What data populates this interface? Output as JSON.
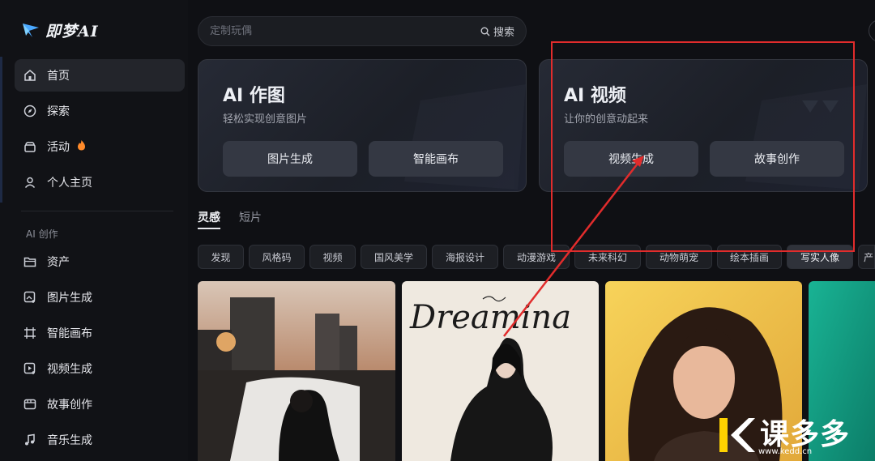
{
  "app": {
    "logo_text": "即梦AI"
  },
  "sidebar": {
    "items": [
      {
        "label": "首页",
        "icon": "home-icon"
      },
      {
        "label": "探索",
        "icon": "compass-icon"
      },
      {
        "label": "活动",
        "icon": "gift-icon",
        "badge_icon": "fire-icon"
      },
      {
        "label": "个人主页",
        "icon": "user-icon"
      }
    ],
    "section_label": "AI 创作",
    "create_items": [
      {
        "label": "资产",
        "icon": "folder-icon"
      },
      {
        "label": "图片生成",
        "icon": "image-generate-icon"
      },
      {
        "label": "智能画布",
        "icon": "canvas-icon"
      },
      {
        "label": "视频生成",
        "icon": "video-generate-icon"
      },
      {
        "label": "故事创作",
        "icon": "story-icon"
      },
      {
        "label": "音乐生成",
        "icon": "music-icon"
      }
    ]
  },
  "search": {
    "placeholder": "定制玩偶",
    "button_label": "搜索"
  },
  "cards": [
    {
      "title": "AI 作图",
      "subtitle": "轻松实现创意图片",
      "buttons": [
        "图片生成",
        "智能画布"
      ]
    },
    {
      "title": "AI 视频",
      "subtitle": "让你的创意动起来",
      "buttons": [
        "视频生成",
        "故事创作"
      ]
    }
  ],
  "tabs": [
    "灵感",
    "短片"
  ],
  "chips": [
    "发现",
    "风格码",
    "视频",
    "国风美学",
    "海报设计",
    "动漫游戏",
    "未来科幻",
    "动物萌宠",
    "绘本插画",
    "写实人像",
    "产"
  ],
  "tiles": {
    "poster_text": "Dreamina"
  },
  "watermark": {
    "text": "课多多",
    "url": "www.kedd.cn"
  },
  "colors": {
    "accent_red": "#e12c2c",
    "background": "#0f1014",
    "logo_blue": "#4aa8ff"
  }
}
